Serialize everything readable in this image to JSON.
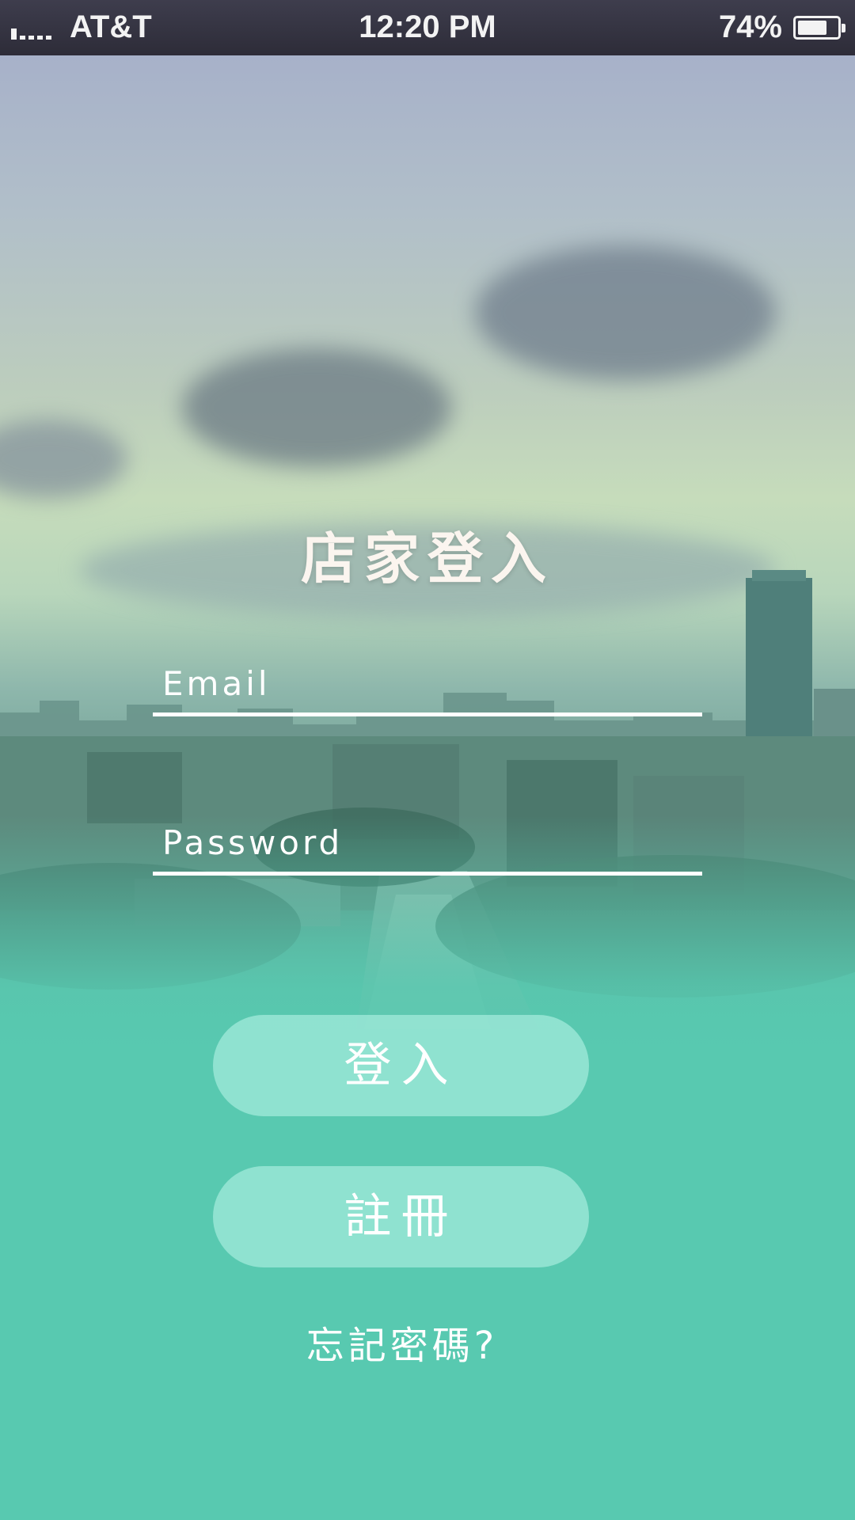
{
  "status_bar": {
    "carrier": "AT&T",
    "time": "12:20 PM",
    "battery_percent": "74%",
    "battery_level": 0.74,
    "signal_bars_filled": 1,
    "signal_bars_total": 5
  },
  "login": {
    "title": "店家登入",
    "email_placeholder": "Email",
    "password_placeholder": "Password",
    "login_button": "登入",
    "register_button": "註冊",
    "forgot_password": "忘記密碼?"
  },
  "colors": {
    "accent": "#58c9b0",
    "button_fill": "#a5ecdd",
    "status_bar": "#34333f"
  }
}
